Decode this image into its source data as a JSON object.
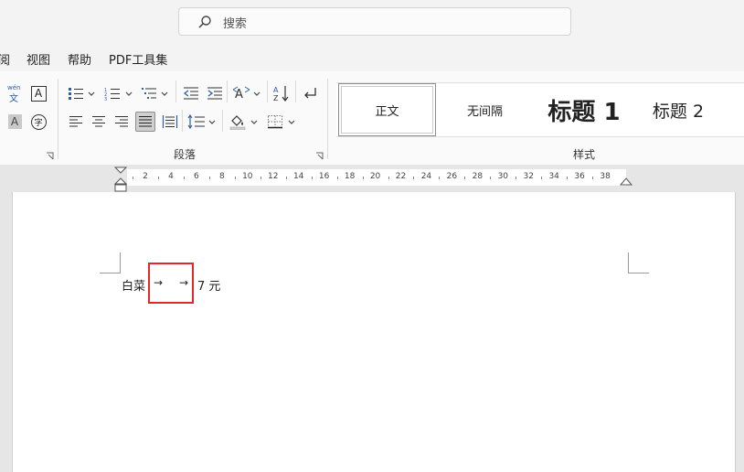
{
  "search": {
    "placeholder": "搜索"
  },
  "menu": {
    "items": [
      "阅",
      "视图",
      "帮助",
      "PDF工具集"
    ]
  },
  "ribbon": {
    "paragraph_label": "段落",
    "styles_label": "样式",
    "styles": [
      {
        "label": "正文",
        "selected": true
      },
      {
        "label": "无间隔",
        "selected": false
      },
      {
        "label": "标题 1",
        "selected": false
      },
      {
        "label": "标题 2",
        "selected": false
      }
    ],
    "phonetic_text": "wén",
    "phonetic_char": "文",
    "char_border_letter": "A",
    "char_shade_letter": "A",
    "enclose_char": "字"
  },
  "ruler": {
    "numbers": [
      "2",
      "4",
      "6",
      "8",
      "10",
      "12",
      "14",
      "16",
      "18",
      "20",
      "22",
      "24",
      "26",
      "28",
      "30",
      "32",
      "34",
      "36",
      "38"
    ]
  },
  "document": {
    "word1": "白菜",
    "tab1": "→",
    "tab2": "→",
    "word2": "7 元"
  },
  "colors": {
    "highlight_box": "#e0282e",
    "selected_align": "#c8c8c8"
  }
}
